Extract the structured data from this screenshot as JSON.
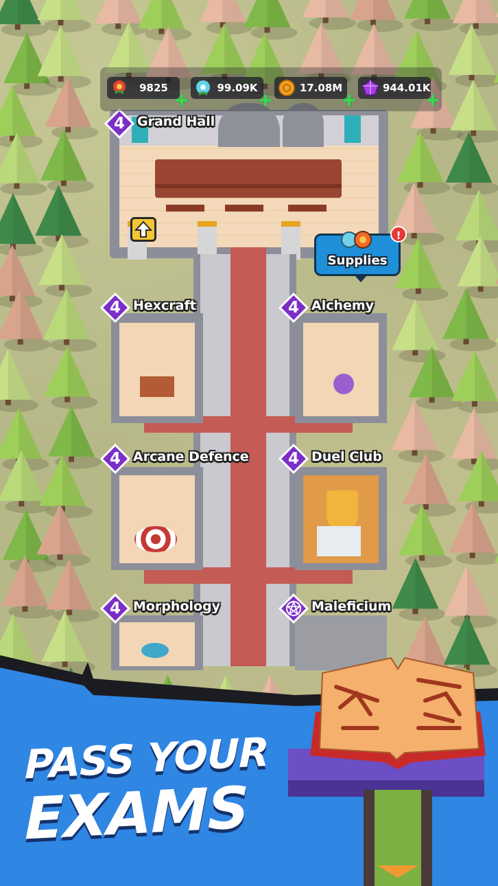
{
  "resources": [
    {
      "name": "nature-essence",
      "icon": "red-flower-icon",
      "value": "9825"
    },
    {
      "name": "crystal",
      "icon": "blue-flower-icon",
      "value": "99.09K"
    },
    {
      "name": "coins",
      "icon": "gold-coin-icon",
      "value": "17.08M"
    },
    {
      "name": "gems",
      "icon": "purple-gem-icon",
      "value": "944.01K"
    }
  ],
  "rooms": [
    {
      "id": "grand-hall",
      "level": "4",
      "name": "Grand Hall"
    },
    {
      "id": "hexcraft",
      "level": "4",
      "name": "Hexcraft"
    },
    {
      "id": "alchemy",
      "level": "4",
      "name": "Alchemy"
    },
    {
      "id": "arcane-defence",
      "level": "4",
      "name": "Arcane Defence"
    },
    {
      "id": "duel-club",
      "level": "4",
      "name": "Duel Club"
    },
    {
      "id": "morphology",
      "level": "4",
      "name": "Morphology"
    },
    {
      "id": "maleficium",
      "level": "",
      "name": "Maleficium",
      "icon": "pentagram-icon"
    }
  ],
  "supplies": {
    "label": "Supplies",
    "alert": "!"
  },
  "promo": {
    "line1": "PASS YOUR",
    "line2": "EXAMS"
  },
  "colors": {
    "level_badge": "#7b2fc7",
    "banner": "#2f86e3",
    "plus": "#35e04b",
    "carpet": "#c45b55"
  }
}
